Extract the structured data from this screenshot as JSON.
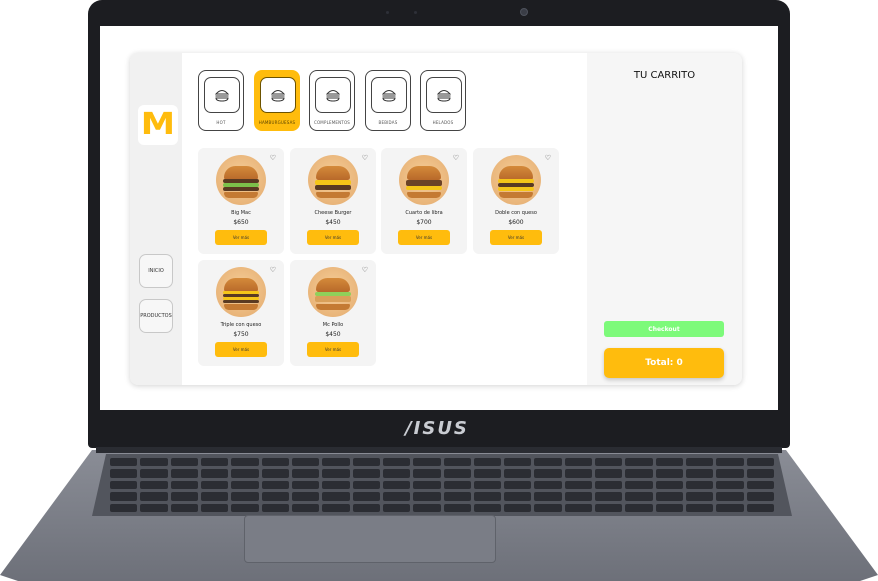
{
  "laptop": {
    "brand": "/ISUS"
  },
  "app": {
    "logo": "M",
    "nav": [
      {
        "label": "INICIO"
      },
      {
        "label": "PRODUCTOS"
      }
    ],
    "categories": [
      {
        "label": "HOT",
        "icon": "burger-icon",
        "active": false
      },
      {
        "label": "HAMBURGUESAS",
        "icon": "burger-icon",
        "active": true
      },
      {
        "label": "COMPLEMENTOS",
        "icon": "burger-icon",
        "active": false
      },
      {
        "label": "BEBIDAS",
        "icon": "burger-icon",
        "active": false
      },
      {
        "label": "HELADOS",
        "icon": "burger-icon",
        "active": false
      }
    ],
    "products": [
      {
        "name": "Big Mac",
        "price": "$650",
        "button": "Ver más",
        "heart": "♡"
      },
      {
        "name": "Cheese Burger",
        "price": "$450",
        "button": "Ver más",
        "heart": "♡"
      },
      {
        "name": "Cuarto de libra",
        "price": "$700",
        "button": "Ver más",
        "heart": "♡"
      },
      {
        "name": "Doble con queso",
        "price": "$600",
        "button": "Ver más",
        "heart": "♡"
      },
      {
        "name": "Triple con queso",
        "price": "$750",
        "button": "Ver más",
        "heart": "♡"
      },
      {
        "name": "Mc Pollo",
        "price": "$450",
        "button": "Ver más",
        "heart": "♡"
      }
    ],
    "cart": {
      "title": "TU CARRITO",
      "checkout_label": "Checkout",
      "total_label": "Total: 0"
    },
    "colors": {
      "accent": "#ffbc0d",
      "checkout": "#7dfa7a"
    }
  }
}
